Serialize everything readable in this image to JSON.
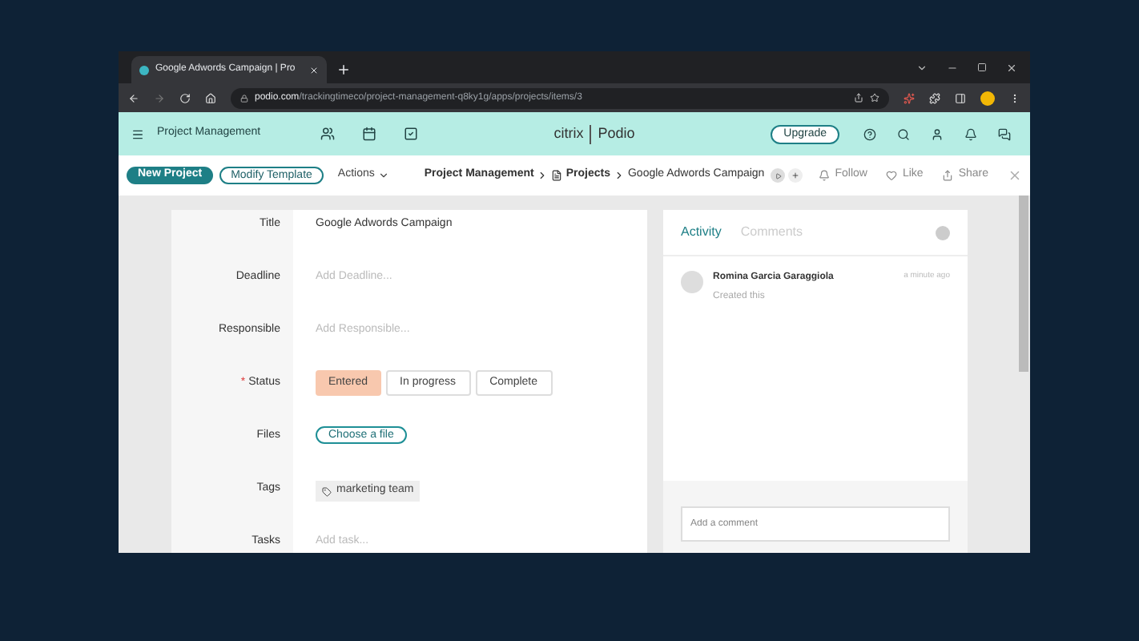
{
  "browser": {
    "tab_title": "Google Adwords Campaign | Pro",
    "url_host": "podio.com",
    "url_path": "/trackingtimeco/project-management-q8ky1g/apps/projects/items/3"
  },
  "app_header": {
    "workspace": "Project Management",
    "brand_left": "citrix",
    "brand_right": "Podio",
    "upgrade": "Upgrade"
  },
  "toolbar": {
    "new_project": "New Project",
    "modify_template": "Modify Template",
    "actions": "Actions",
    "breadcrumbs": [
      "Project Management",
      "Projects",
      "Google Adwords Campaign"
    ],
    "follow": "Follow",
    "like": "Like",
    "share": "Share"
  },
  "fields": [
    {
      "kind": "text",
      "label": "Title",
      "value": "Google Adwords Campaign"
    },
    {
      "kind": "placeholder",
      "label": "Deadline",
      "placeholder": "Add Deadline..."
    },
    {
      "kind": "placeholder",
      "label": "Responsible",
      "placeholder": "Add Responsible..."
    },
    {
      "kind": "status",
      "label": "Status",
      "required_mark": "*",
      "options": [
        {
          "label": "Entered",
          "selected": true
        },
        {
          "label": "In progress",
          "selected": false
        },
        {
          "label": "Complete",
          "selected": false
        }
      ]
    },
    {
      "kind": "file",
      "label": "Files",
      "value": "Choose a file"
    },
    {
      "kind": "tag",
      "label": "Tags",
      "value": "marketing team"
    },
    {
      "kind": "placeholder",
      "label": "Tasks",
      "placeholder": "Add task..."
    }
  ],
  "activity": {
    "tabs": [
      {
        "label": "Activity",
        "selected": true
      },
      {
        "label": "Comments",
        "selected": false
      }
    ],
    "items": [
      {
        "name": "Romina Garcia Garaggiola",
        "action": "Created this",
        "time": "a minute ago"
      }
    ],
    "comment_placeholder": "Add a comment"
  }
}
